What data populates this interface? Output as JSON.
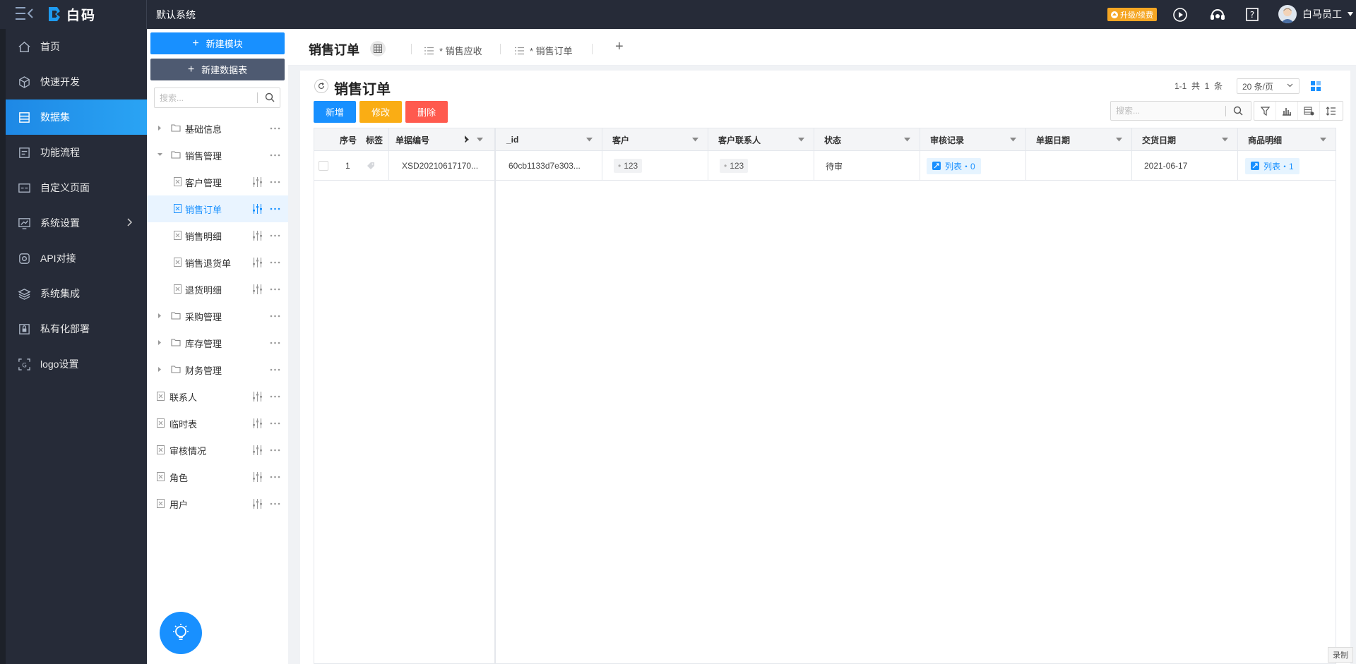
{
  "topbar": {
    "logo_text": "白码",
    "system_name": "默认系统",
    "upgrade_label": "升级/续费",
    "user_name": "白马员工"
  },
  "nav": {
    "items": [
      {
        "label": "首页",
        "icon": "home-icon"
      },
      {
        "label": "快速开发",
        "icon": "cube-icon"
      },
      {
        "label": "数据集",
        "icon": "database-icon",
        "active": true
      },
      {
        "label": "功能流程",
        "icon": "flow-icon"
      },
      {
        "label": "自定义页面",
        "icon": "page-icon"
      },
      {
        "label": "系统设置",
        "icon": "settings-icon"
      },
      {
        "label": "API对接",
        "icon": "api-icon"
      },
      {
        "label": "系统集成",
        "icon": "layers-icon"
      },
      {
        "label": "私有化部署",
        "icon": "lock-icon"
      },
      {
        "label": "logo设置",
        "icon": "logo-icon"
      }
    ]
  },
  "tree": {
    "new_module_label": "新建模块",
    "new_table_label": "新建数据表",
    "search_placeholder": "搜索...",
    "rows": [
      {
        "label": "基础信息",
        "type": "folder"
      },
      {
        "label": "销售管理",
        "type": "folder"
      },
      {
        "label": "客户管理",
        "type": "table"
      },
      {
        "label": "销售订单",
        "type": "table",
        "selected": true
      },
      {
        "label": "销售明细",
        "type": "table"
      },
      {
        "label": "销售退货单",
        "type": "table"
      },
      {
        "label": "退货明细",
        "type": "table"
      },
      {
        "label": "采购管理",
        "type": "folder"
      },
      {
        "label": "库存管理",
        "type": "folder"
      },
      {
        "label": "财务管理",
        "type": "folder"
      },
      {
        "label": "联系人",
        "type": "table"
      },
      {
        "label": "临时表",
        "type": "table"
      },
      {
        "label": "审核情况",
        "type": "table"
      },
      {
        "label": "角色",
        "type": "table"
      },
      {
        "label": "用户",
        "type": "table"
      }
    ]
  },
  "tabs": {
    "title": "销售订单",
    "items": [
      "* 销售应收",
      "* 销售订单"
    ]
  },
  "card": {
    "title": "销售订单",
    "add_label": "新增",
    "edit_label": "修改",
    "delete_label": "删除",
    "pager_text": "1-1  共  1  条",
    "page_size": "20 条/页",
    "search_placeholder": "搜索..."
  },
  "table": {
    "headers": [
      "序号",
      "标签",
      "单据编号",
      "_id",
      "客户",
      "客户联系人",
      "状态",
      "审核记录",
      "单据日期",
      "交货日期",
      "商品明细"
    ],
    "rows": [
      {
        "index": "1",
        "order_no": "XSD20210617170...",
        "id": "60cb1133d7e303...",
        "customer": "123",
        "contact": "123",
        "status": "待审",
        "audit": "列表・0",
        "doc_date": "",
        "delivery_date": "2021-06-17",
        "items": "列表・1"
      }
    ]
  },
  "footer": {
    "record_label": "录制"
  }
}
